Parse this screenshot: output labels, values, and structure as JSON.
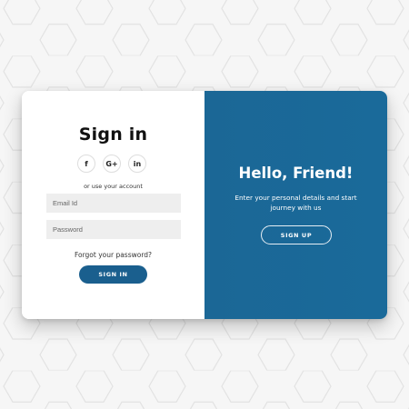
{
  "signin_panel": {
    "title": "Sign in",
    "social_buttons": [
      {
        "label": "f",
        "icon": "facebook-icon"
      },
      {
        "label": "G+",
        "icon": "google-plus-icon"
      },
      {
        "label": "in",
        "icon": "linkedin-icon"
      }
    ],
    "hint": "or use your account",
    "email_placeholder": "Email Id",
    "password_placeholder": "Password",
    "forgot_link": "Forgot your password?",
    "signin_button": "SIGN IN"
  },
  "overlay_panel": {
    "title": "Hello, Friend!",
    "description": "Enter your personal details and start journey with us",
    "signup_button": "SIGN UP"
  },
  "colors": {
    "accent": "#1b6796",
    "button": "#1a5f8e",
    "background": "#f6f6f6"
  }
}
